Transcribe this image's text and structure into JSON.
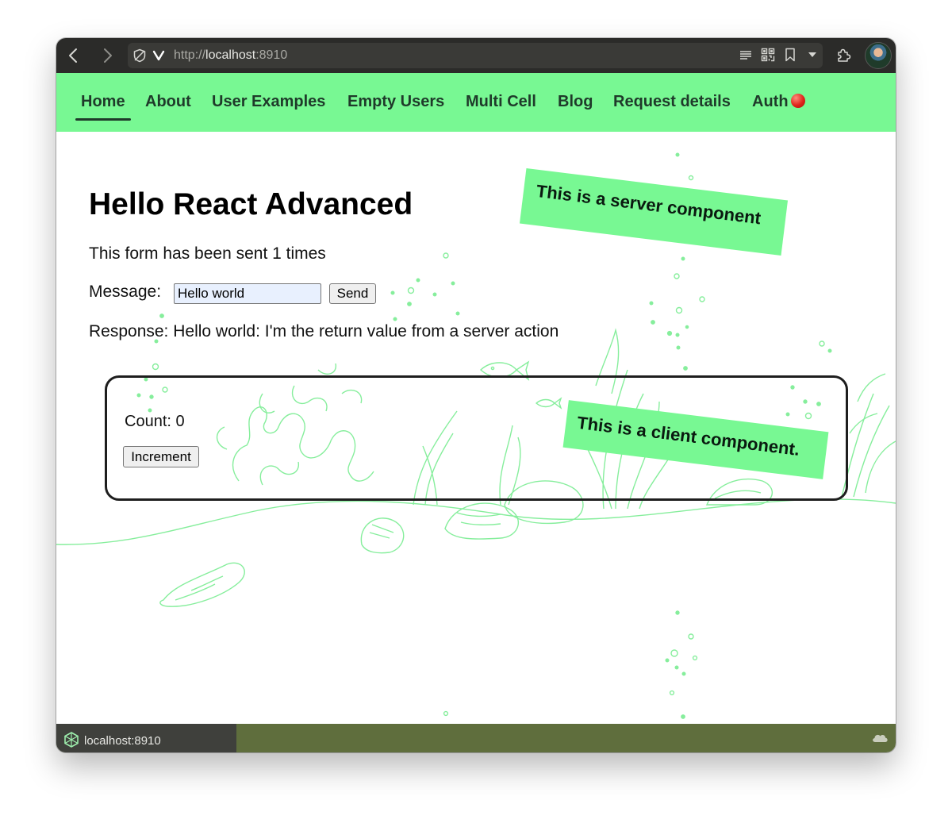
{
  "browser": {
    "url_scheme": "http://",
    "url_host": "localhost",
    "url_port": ":8910",
    "icons": [
      "back-icon",
      "forward-icon",
      "shield-icon",
      "vivaldi-icon",
      "reader-icon",
      "qr-code-icon",
      "bookmark-icon",
      "dropdown-icon",
      "extensions-icon",
      "avatar"
    ]
  },
  "nav": {
    "items": [
      {
        "label": "Home",
        "active": true
      },
      {
        "label": "About"
      },
      {
        "label": "User Examples"
      },
      {
        "label": "Empty Users"
      },
      {
        "label": "Multi Cell"
      },
      {
        "label": "Blog"
      },
      {
        "label": "Request details"
      },
      {
        "label": "Auth"
      }
    ]
  },
  "main": {
    "title": "Hello React Advanced",
    "form_sent_text": "This form has been sent 1 times",
    "message_label": "Message:",
    "message_value": "Hello world",
    "send_label": "Send",
    "response_text": "Response: Hello world: I'm the return value from a server action",
    "server_banner": "This is a server component",
    "client": {
      "count_text": "Count: 0",
      "increment_label": "Increment",
      "banner": "This is a client component."
    }
  },
  "statusbar": {
    "host": "localhost:8910"
  },
  "colors": {
    "accent_green": "#78f893",
    "toolbar": "#2b2b29",
    "statusbar": "#5f6e3d",
    "nav_text": "#1f3a2a"
  }
}
